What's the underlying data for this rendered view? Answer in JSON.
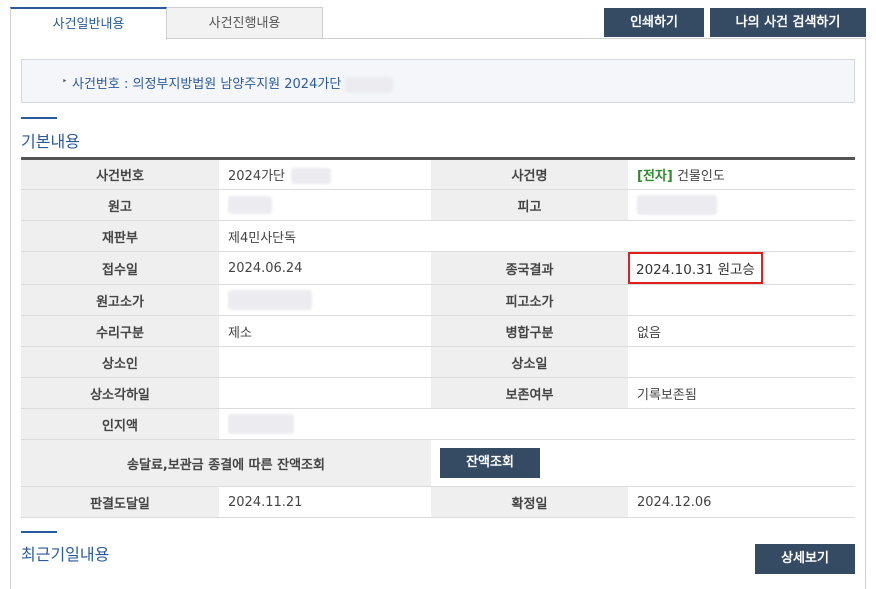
{
  "tabs": [
    {
      "label": "사건일반내용",
      "active": true
    },
    {
      "label": "사건진행내용",
      "active": false
    }
  ],
  "toolbar": {
    "print_label": "인쇄하기",
    "my_case_search_label": "나의 사건 검색하기"
  },
  "case_header": {
    "text": "사건번호 : 의정부지방법원 남양주지원 2024가단"
  },
  "basic_section": {
    "title": "기본내용",
    "rows": [
      {
        "l1": "사건번호",
        "v1": "2024가단",
        "l2": "사건명",
        "v2_tag": "[전자]",
        "v2": "건물인도"
      },
      {
        "l1": "원고",
        "v1": "",
        "l2": "피고",
        "v2": ""
      },
      {
        "l1": "재판부",
        "v1": "제4민사단독"
      },
      {
        "l1": "접수일",
        "v1": "2024.06.24",
        "l2": "종국결과",
        "v2": "2024.10.31 원고승"
      },
      {
        "l1": "원고소가",
        "v1": "",
        "l2": "피고소가",
        "v2": ""
      },
      {
        "l1": "수리구분",
        "v1": "제소",
        "l2": "병합구분",
        "v2": "없음"
      },
      {
        "l1": "상소인",
        "v1": "",
        "l2": "상소일",
        "v2": ""
      },
      {
        "l1": "상소각하일",
        "v1": "",
        "l2": "보존여부",
        "v2": "기록보존됨"
      },
      {
        "l1": "인지액",
        "v1": ""
      },
      {
        "l1": "송달료,보관금 종결에 따른 잔액조회",
        "button": "잔액조회"
      },
      {
        "l1": "판결도달일",
        "v1": "2024.11.21",
        "l2": "확정일",
        "v2": "2024.12.06"
      }
    ]
  },
  "recent_section": {
    "title": "최근기일내용",
    "detail_label": "상세보기"
  },
  "colors": {
    "accent": "#2a5a9a",
    "button_bg": "#344b63",
    "highlight_box": "#e02020",
    "electronic_tag": "#2d8a2d"
  }
}
